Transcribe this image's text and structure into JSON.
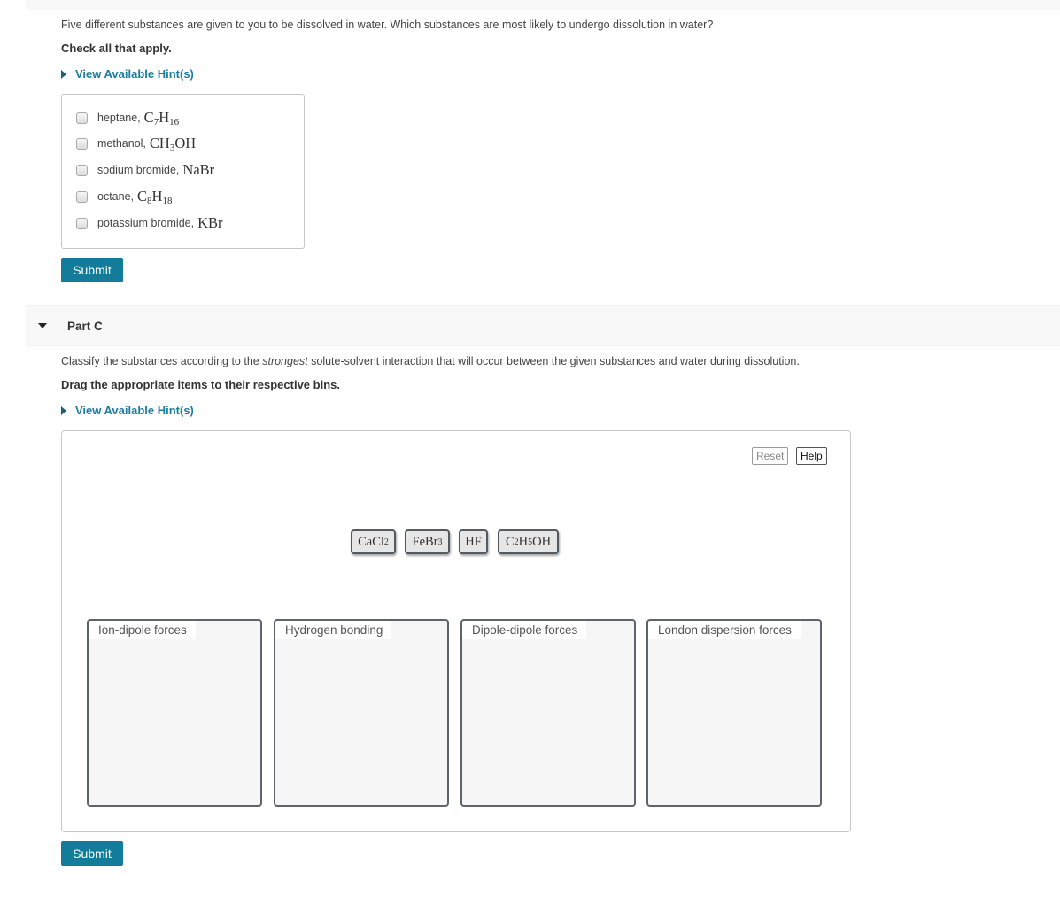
{
  "partB": {
    "prompt": "Five different substances are given to you to be dissolved in water. Which substances are most likely to undergo dissolution in water?",
    "instruction": "Check all that apply.",
    "hint_link": "View Available Hint(s)",
    "choices": [
      {
        "name": "heptane,",
        "formula": [
          [
            "C",
            "7"
          ],
          [
            "H",
            "16"
          ]
        ],
        "checked": false
      },
      {
        "name": "methanol,",
        "formula": [
          [
            "CH",
            "3"
          ],
          [
            "OH",
            ""
          ]
        ],
        "checked": false
      },
      {
        "name": "sodium bromide,",
        "formula": [
          [
            "NaBr",
            ""
          ]
        ],
        "checked": false
      },
      {
        "name": "octane,",
        "formula": [
          [
            "C",
            "8"
          ],
          [
            "H",
            "18"
          ]
        ],
        "checked": false
      },
      {
        "name": "potassium bromide,",
        "formula": [
          [
            "KBr",
            ""
          ]
        ],
        "checked": false
      }
    ],
    "submit_label": "Submit"
  },
  "partC": {
    "title": "Part C",
    "prompt_before": "Classify the substances according to the ",
    "prompt_emphasis": "strongest",
    "prompt_after": " solute-solvent interaction that will occur between the given substances and water during dissolution.",
    "instruction": "Drag the appropriate items to their respective bins.",
    "hint_link": "View Available Hint(s)",
    "reset_label": "Reset",
    "help_label": "Help",
    "items": [
      {
        "formula": [
          [
            "CaCl",
            "2"
          ]
        ]
      },
      {
        "formula": [
          [
            "FeBr",
            "3"
          ]
        ]
      },
      {
        "formula": [
          [
            "HF",
            ""
          ]
        ]
      },
      {
        "formula": [
          [
            "C",
            "2"
          ],
          [
            "H",
            "5"
          ],
          [
            "OH",
            ""
          ]
        ]
      }
    ],
    "bins": [
      {
        "label": "Ion-dipole forces"
      },
      {
        "label": "Hydrogen bonding"
      },
      {
        "label": "Dipole-dipole forces"
      },
      {
        "label": "London dispersion forces"
      }
    ],
    "submit_label": "Submit"
  },
  "colors": {
    "accent": "#137c9b",
    "link": "#1a7ea1",
    "header_bg": "#f8f8f8"
  }
}
